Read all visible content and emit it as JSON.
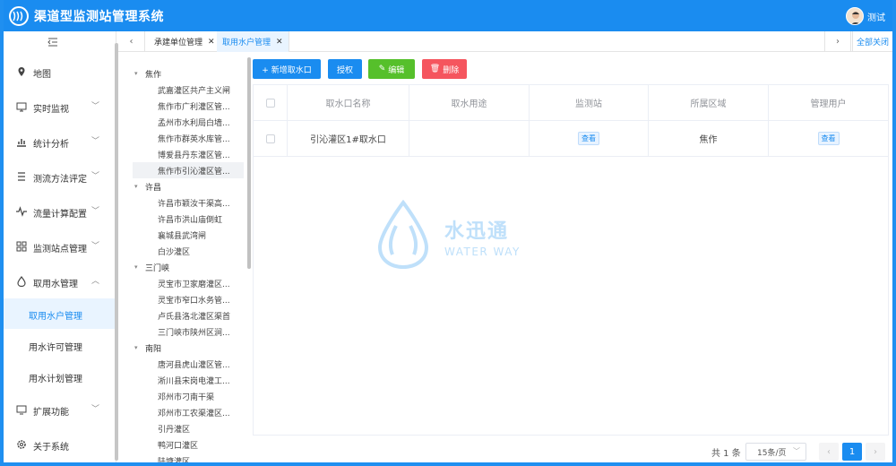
{
  "app": {
    "title": "渠道型监测站管理系统",
    "user": "测试"
  },
  "colors": {
    "primary": "#1a8cf0",
    "success": "#56c02b",
    "danger": "#f5555e"
  },
  "sidebar": {
    "items": [
      {
        "label": "地图",
        "icon": "location-icon"
      },
      {
        "label": "实时监视",
        "icon": "monitor-icon"
      },
      {
        "label": "统计分析",
        "icon": "chart-icon"
      },
      {
        "label": "测流方法评定",
        "icon": "list-icon"
      },
      {
        "label": "流量计算配置",
        "icon": "pulse-icon"
      },
      {
        "label": "监测站点管理",
        "icon": "grid-icon"
      },
      {
        "label": "取用水管理",
        "icon": "drop-icon"
      }
    ],
    "subitems": [
      {
        "label": "取用水户管理"
      },
      {
        "label": "用水许可管理"
      },
      {
        "label": "用水计划管理"
      }
    ],
    "bottom": [
      {
        "label": "扩展功能",
        "icon": "extension-icon"
      },
      {
        "label": "关于系统",
        "icon": "gear-icon"
      }
    ]
  },
  "tabs": {
    "items": [
      {
        "label": "承建单位管理"
      },
      {
        "label": "取用水户管理"
      }
    ],
    "close_all": "全部关闭"
  },
  "tree": {
    "groups": [
      {
        "label": "焦作",
        "leaves": [
          "武嘉灌区共产主义闸",
          "焦作市广利灌区管...",
          "孟州市水利局白墙...",
          "焦作市群英水库管...",
          "博爱县丹东灌区管...",
          "焦作市引沁灌区管..."
        ]
      },
      {
        "label": "许昌",
        "leaves": [
          "许昌市颖汝干渠高...",
          "许昌市洪山庙倒虹",
          "襄城县武湾闸",
          "白沙灌区"
        ]
      },
      {
        "label": "三门峡",
        "leaves": [
          "灵宝市卫家磨灌区...",
          "灵宝市窄口水务管...",
          "卢氏县洛北灌区渠首",
          "三门峡市陕州区涧..."
        ]
      },
      {
        "label": "南阳",
        "leaves": [
          "唐河县虎山灌区管...",
          "淅川县宋岗电灌工...",
          "邓州市刁南干渠",
          "邓州市工农渠灌区...",
          "引丹灌区",
          "鸭河口灌区",
          "陆塘灌区"
        ]
      }
    ]
  },
  "toolbar": {
    "add": "+ 新增取水口",
    "grant": "授权",
    "edit": "编辑",
    "delete": "删除"
  },
  "table": {
    "headers": [
      "取水口名称",
      "取水用途",
      "监测站",
      "所属区域",
      "管理用户"
    ],
    "rows": [
      {
        "name": "引沁灌区1#取水口",
        "use": "",
        "station": "查看",
        "area": "焦作",
        "user": "查看"
      }
    ]
  },
  "watermark": {
    "title": "水迅通",
    "subtitle": "WATER WAY"
  },
  "pager": {
    "total": "共 1 条",
    "page_size": "15条/页",
    "current": "1"
  }
}
